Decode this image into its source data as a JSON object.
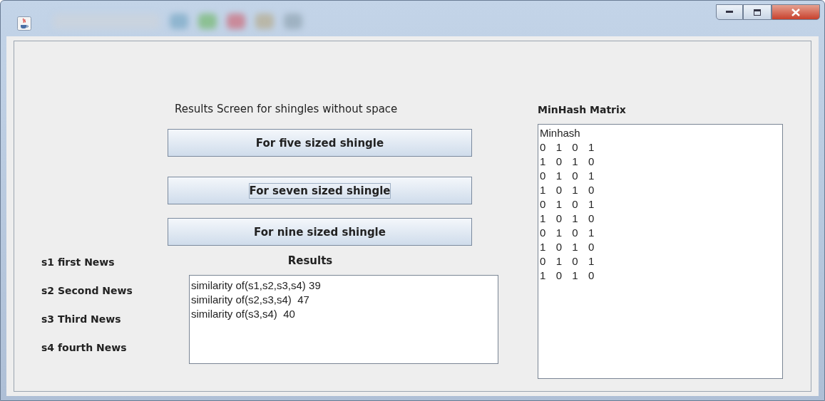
{
  "heading": "Results Screen for shingles without space",
  "buttons": [
    {
      "label": "For five sized shingle",
      "focused": false
    },
    {
      "label": "For seven sized shingle",
      "focused": true
    },
    {
      "label": "For nine sized shingle",
      "focused": false
    }
  ],
  "news_labels": [
    "s1 first News",
    "s2 Second News",
    "s3 Third News",
    "s4 fourth News"
  ],
  "results": {
    "title": "Results",
    "lines": [
      "similarity of(s1,s2,s3,s4) 39",
      "similarity of(s2,s3,s4)  47",
      "similarity of(s3,s4)  40"
    ]
  },
  "minhash": {
    "title": "MinHash Matrix",
    "header": "Minhash",
    "rows": [
      [
        "0",
        "1",
        "0",
        "1"
      ],
      [
        "1",
        "0",
        "1",
        "0"
      ],
      [
        "0",
        "1",
        "0",
        "1"
      ],
      [
        "1",
        "0",
        "1",
        "0"
      ],
      [
        "0",
        "1",
        "0",
        "1"
      ],
      [
        "1",
        "0",
        "1",
        "0"
      ],
      [
        "0",
        "1",
        "0",
        "1"
      ],
      [
        "1",
        "0",
        "1",
        "0"
      ],
      [
        "0",
        "1",
        "0",
        "1"
      ],
      [
        "1",
        "0",
        "1",
        "0"
      ]
    ]
  }
}
